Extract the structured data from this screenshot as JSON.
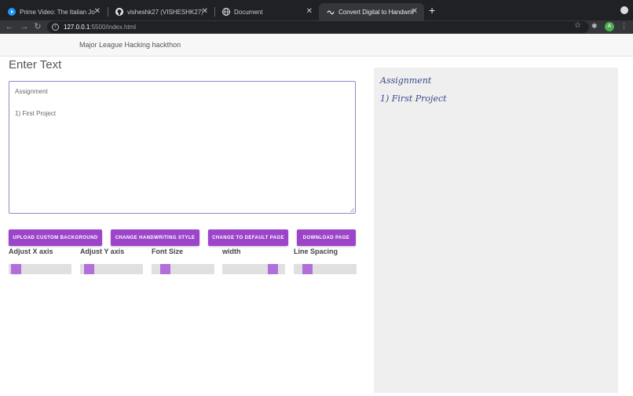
{
  "browser": {
    "tabs": [
      {
        "title": "Prime Video: The Italian Job (2",
        "icon": "prime-video-icon",
        "active": false
      },
      {
        "title": "visheshk27 (VISHESHK27)",
        "icon": "github-icon",
        "active": false
      },
      {
        "title": "Document",
        "icon": "globe-icon",
        "active": false
      },
      {
        "title": "Convert Digital to Handwritten",
        "icon": "handwriting-icon",
        "active": true
      }
    ],
    "close_glyph": "✕",
    "new_tab_glyph": "+",
    "url_host": "127.0.0.1",
    "url_path": ":5500/index.html",
    "avatar_initial": "A"
  },
  "page": {
    "brand": "Major League Hacking hackthon",
    "heading": "Enter Text",
    "textarea_value": "Assignment\n\n1) First Project",
    "buttons": {
      "upload": "UPLOAD CUSTOM BACKGROUND",
      "change_style": "CHANGE HANDWRITING STYLE",
      "default_page": "CHANGE TO DEFAULT PAGE",
      "download": "DOWNLOAD PAGE"
    },
    "controls": [
      {
        "label": "Adjust X axis",
        "value": 0.04
      },
      {
        "label": "Adjust Y axis",
        "value": 0.08
      },
      {
        "label": "Font Size",
        "value": 0.16
      },
      {
        "label": "width",
        "value": 0.86
      },
      {
        "label": "Line Spacing",
        "value": 0.16
      }
    ],
    "preview_lines": [
      "Assignment",
      "1) First Project"
    ]
  },
  "colors": {
    "accent": "#9c45c9",
    "slider_thumb": "#b26fda",
    "ink": "#3a4a8c"
  }
}
